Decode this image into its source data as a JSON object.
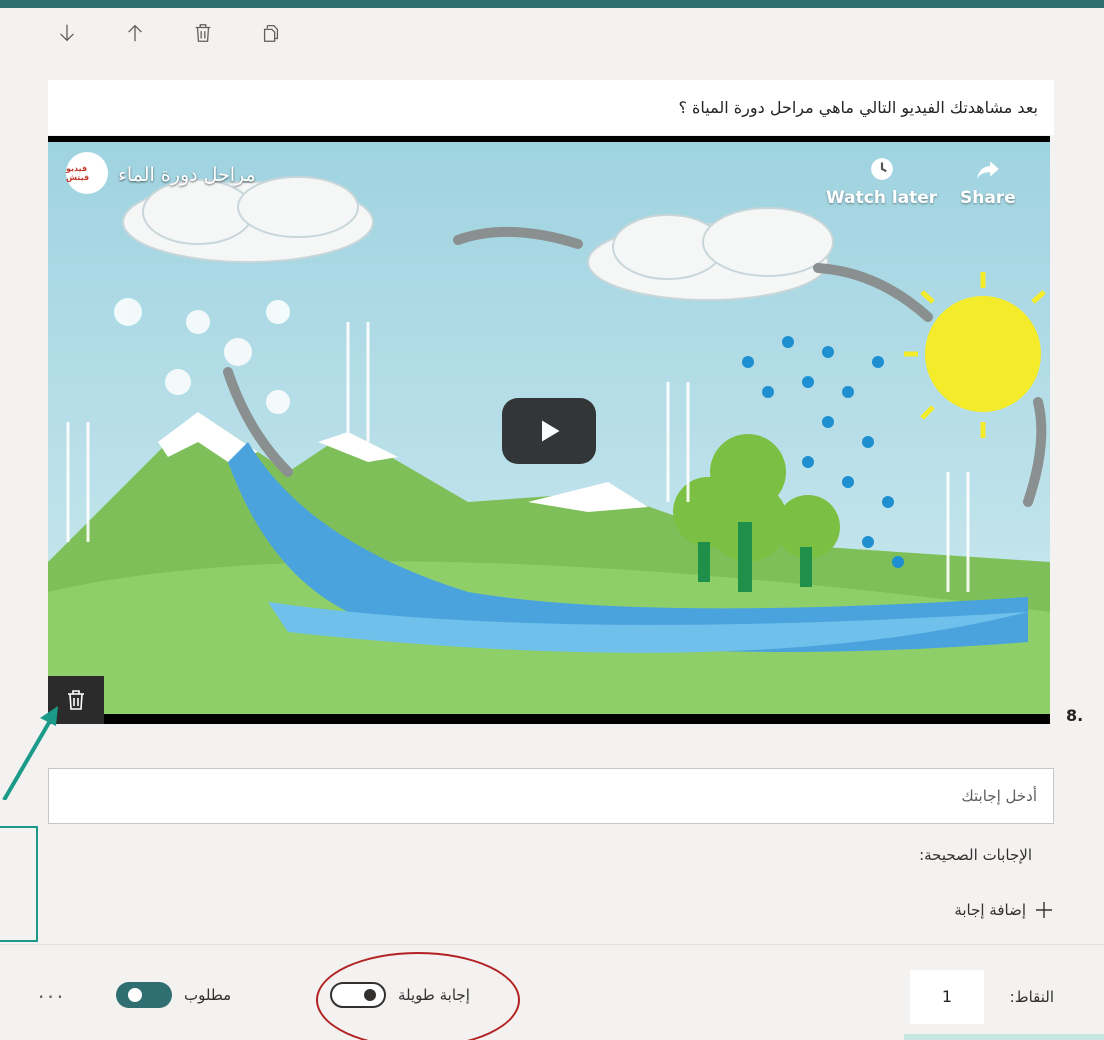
{
  "toolbar": {
    "icons": [
      "move-down-icon",
      "move-up-icon",
      "delete-icon",
      "copy-icon"
    ]
  },
  "question": {
    "number": "8.",
    "text": "بعد مشاهدتك الفيديو التالي ماهي مراحل دورة المياة ؟"
  },
  "video": {
    "title": "مراحل دورة الماء",
    "channel_logo_text": "فيديو فيتش",
    "watch_later": "Watch later",
    "share": "Share"
  },
  "answer": {
    "placeholder": "أدخل إجابتك"
  },
  "correct_answers": {
    "label": "الإجابات الصحيحة:",
    "add_label": "إضافة إجابة"
  },
  "footer": {
    "points_label": "النقاط:",
    "points_value": "1",
    "long_answer_label": "إجابة طويلة",
    "long_answer_on": false,
    "required_label": "مطلوب",
    "required_on": true,
    "more_label": "···"
  },
  "colors": {
    "accent": "#2f6f72",
    "annotation_red": "#b22222",
    "annotation_teal": "#1b9a8a"
  }
}
